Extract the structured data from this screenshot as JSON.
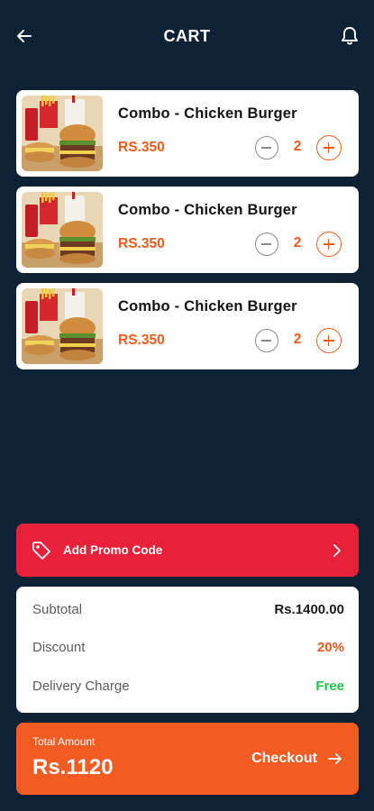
{
  "header": {
    "title": "CART",
    "back_icon": "arrow-left-icon",
    "bell_icon": "bell-icon"
  },
  "cart": {
    "items": [
      {
        "name": "Combo - Chicken Burger",
        "price": "RS.350",
        "quantity": "2"
      },
      {
        "name": "Combo - Chicken Burger",
        "price": "RS.350",
        "quantity": "2"
      },
      {
        "name": "Combo - Chicken Burger",
        "price": "RS.350",
        "quantity": "2"
      }
    ]
  },
  "promo": {
    "label": "Add Promo Code",
    "icon": "tag-icon",
    "chevron_icon": "chevron-right-icon"
  },
  "summary": {
    "subtotal_label": "Subtotal",
    "subtotal_value": "Rs.1400.00",
    "discount_label": "Discount",
    "discount_value": "20%",
    "delivery_label": "Delivery Charge",
    "delivery_value": "Free"
  },
  "checkout": {
    "total_label": "Total Amount",
    "total_value": "Rs.1120",
    "button_label": "Checkout",
    "arrow_icon": "arrow-right-icon"
  },
  "colors": {
    "background": "#0e2236",
    "accent": "#f05a1a",
    "promo": "#e8203a",
    "free": "#1fc44a"
  }
}
